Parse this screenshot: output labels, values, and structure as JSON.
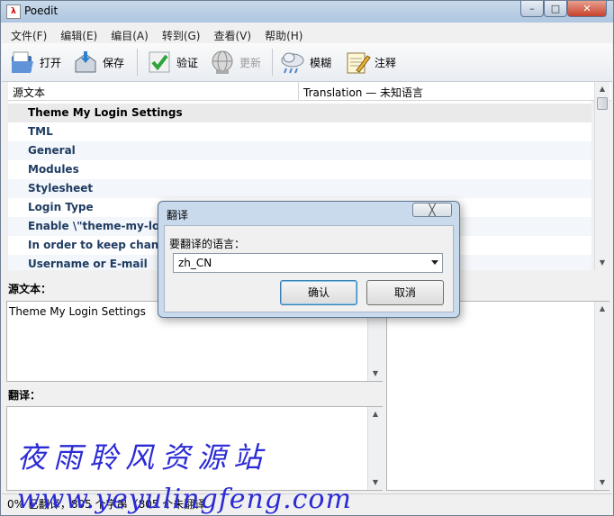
{
  "window": {
    "title": "Poedit",
    "app_icon_glyph": "λ",
    "controls": {
      "minimize": "–",
      "maximize": "□",
      "close": "✕"
    }
  },
  "menu": [
    "文件(F)",
    "编辑(E)",
    "编目(A)",
    "转到(G)",
    "查看(V)",
    "帮助(H)"
  ],
  "toolbar": {
    "open": {
      "label": "打开",
      "icon": "open-folder-icon"
    },
    "save": {
      "label": "保存",
      "icon": "save-icon"
    },
    "validate": {
      "label": "验证",
      "icon": "checkmark-icon"
    },
    "update": {
      "label": "更新",
      "icon": "globe-update-icon",
      "disabled": true
    },
    "fuzzy": {
      "label": "模糊",
      "icon": "cloud-icon"
    },
    "comment": {
      "label": "注释",
      "icon": "notepad-pencil-icon"
    }
  },
  "list": {
    "columns": [
      "源文本",
      "Translation — 未知语言"
    ],
    "rows": [
      "Theme My Login Settings",
      "TML",
      "General",
      "Modules",
      "Stylesheet",
      "Login Type",
      "Enable \\\"theme-my-log",
      "In order to keep change",
      "Username or E-mail"
    ],
    "selected_index": 0
  },
  "source_pane": {
    "label": "源文本：",
    "text": "Theme My Login Settings"
  },
  "translation_pane": {
    "label": "翻译："
  },
  "status": "0% 已翻译，805 个字串（805 个未翻译",
  "watermark": {
    "line1": "夜雨聆风资源站",
    "line2": "www.yeyulingfeng.com"
  },
  "dialog": {
    "title": "翻译",
    "close": "╳",
    "prompt": "要翻译的语言：",
    "language_value": "zh_CN",
    "ok": "确认",
    "cancel": "取消"
  },
  "colors": {
    "title_bar": "#aec6df",
    "dialog_frame": "#c9daed",
    "list_text": "#1f3c62",
    "watermark": "#2b2bd6"
  }
}
